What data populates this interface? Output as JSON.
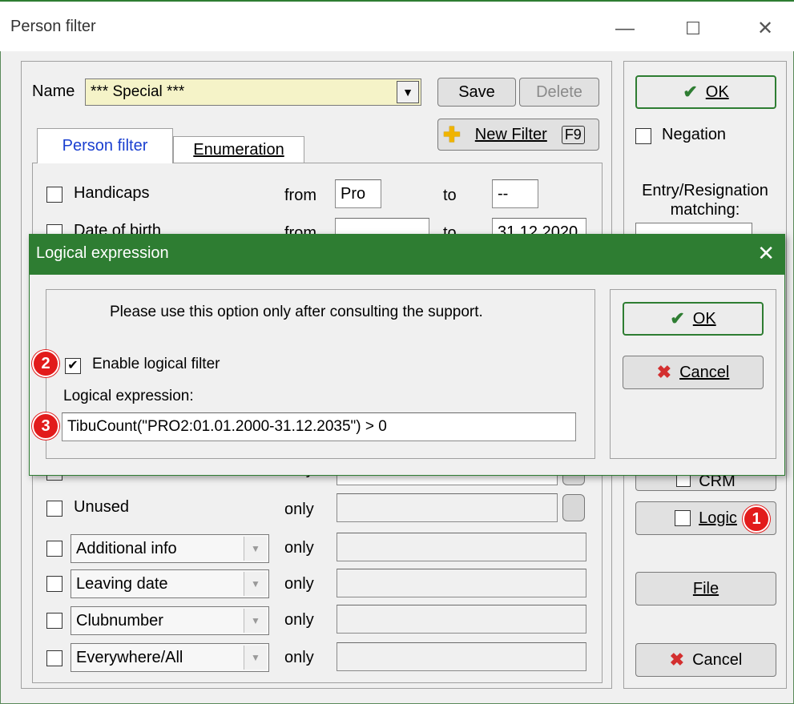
{
  "window": {
    "title": "Person filter",
    "minimize": "—",
    "maximize": "☐",
    "close": "✕"
  },
  "name_row": {
    "label": "Name",
    "value": "*** Special ***",
    "save": "Save",
    "delete": "Delete",
    "new_filter": "New Filter",
    "new_filter_key": "F9"
  },
  "tabs": {
    "person_filter": "Person filter",
    "enumeration": "Enumeration"
  },
  "rows": {
    "handicaps": {
      "label": "Handicaps",
      "from": "from",
      "from_value": "Pro",
      "to": "to",
      "to_value": "--"
    },
    "date_of_birth": {
      "label": "Date of birth",
      "from": "from",
      "to": "to",
      "to_value": "31.12.2020"
    },
    "hidden_only": "only",
    "unused": {
      "label": "Unused",
      "only": "only"
    },
    "additional_info": {
      "label": "Additional info",
      "only": "only"
    },
    "leaving_date": {
      "label": "Leaving date",
      "only": "only"
    },
    "clubnumber": {
      "label": "Clubnumber",
      "only": "only"
    },
    "everywhere": {
      "label": "Everywhere/All",
      "only": "only"
    }
  },
  "right_panel": {
    "ok": "OK",
    "negation": "Negation",
    "entry_resignation": "Entry/Resignation matching:",
    "crm": "CRM",
    "logic": "Logic",
    "file": "File",
    "cancel": "Cancel"
  },
  "dialog": {
    "title": "Logical expression",
    "close": "✕",
    "notice": "Please use this option only after consulting the support.",
    "enable_label": "Enable logical filter",
    "enable_checked": true,
    "expr_label": "Logical expression:",
    "expr_value": "TibuCount(\"PRO2:01.01.2000-31.12.2035\") > 0",
    "ok": "OK",
    "cancel": "Cancel"
  },
  "badges": {
    "one": "1",
    "two": "2",
    "three": "3"
  },
  "colors": {
    "accent_green": "#2e7d32",
    "badge_red": "#e21b1b",
    "name_field_bg": "#f5f3c8"
  }
}
